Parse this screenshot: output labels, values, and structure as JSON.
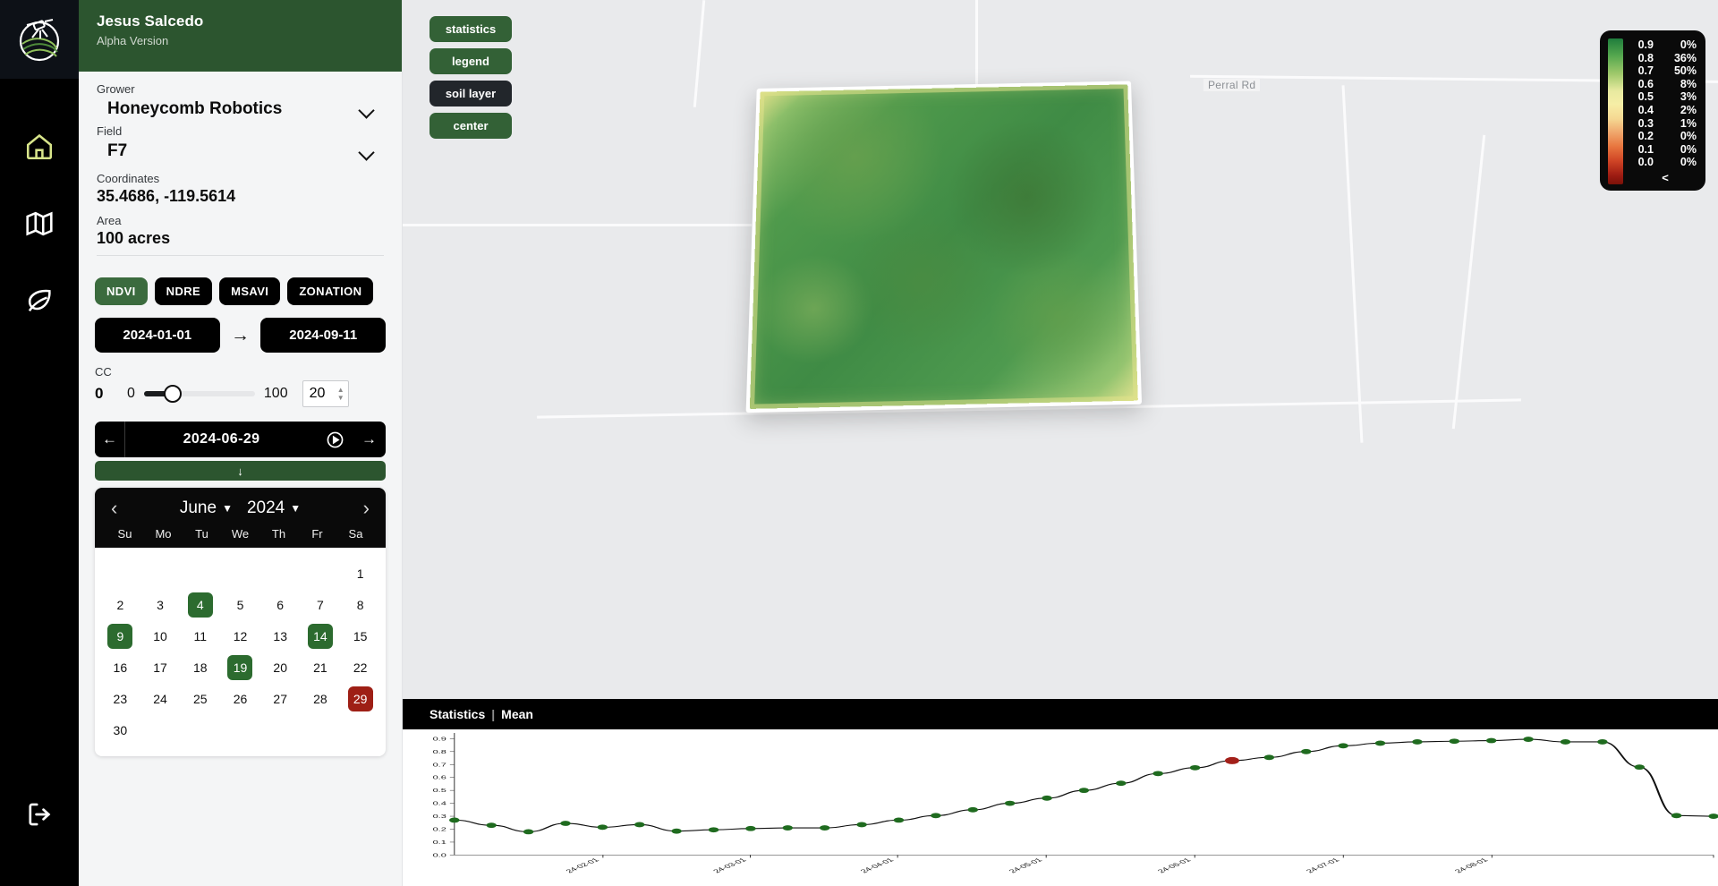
{
  "rail": {
    "logo_icon": "satellite-field-logo",
    "items": [
      {
        "icon": "home-icon",
        "name": "home",
        "active": true
      },
      {
        "icon": "map-icon",
        "name": "map",
        "active": false
      },
      {
        "icon": "leaf-icon",
        "name": "crops",
        "active": false
      }
    ],
    "logout_icon": "logout-icon"
  },
  "panel": {
    "user_name": "Jesus Salcedo",
    "version": "Alpha Version",
    "grower_label": "Grower",
    "grower_value": "Honeycomb Robotics",
    "field_label": "Field",
    "field_value": "F7",
    "coordinates_label": "Coordinates",
    "coordinates_value": "35.4686, -119.5614",
    "area_label": "Area",
    "area_value": "100 acres",
    "indices": [
      {
        "label": "NDVI",
        "active": true
      },
      {
        "label": "NDRE",
        "active": false
      },
      {
        "label": "MSAVI",
        "active": false
      },
      {
        "label": "ZONATION",
        "active": false
      }
    ],
    "date_from": "2024-01-01",
    "date_to": "2024-09-11",
    "date_range_arrow": "arrow-right-icon",
    "cc_label": "CC",
    "cc_current": "0",
    "cc_min": "0",
    "cc_max": "100",
    "cc_value": "20",
    "nav": {
      "prev_icon": "arrow-left-icon",
      "current_date": "2024-06-29",
      "play_icon": "play-circle-icon",
      "next_icon": "arrow-right-icon",
      "expand_icon": "arrow-down-icon"
    },
    "calendar": {
      "prev_icon": "chevron-left-icon",
      "next_icon": "chevron-right-icon",
      "month": "June",
      "year": "2024",
      "dow": [
        "Su",
        "Mo",
        "Tu",
        "We",
        "Th",
        "Fr",
        "Sa"
      ],
      "leading_blanks": 6,
      "days": [
        1,
        2,
        3,
        4,
        5,
        6,
        7,
        8,
        9,
        10,
        11,
        12,
        13,
        14,
        15,
        16,
        17,
        18,
        19,
        20,
        21,
        22,
        23,
        24,
        25,
        26,
        27,
        28,
        29,
        30
      ],
      "available_days": [
        4,
        9,
        14,
        19
      ],
      "selected_day": 29
    }
  },
  "map": {
    "buttons": [
      {
        "label": "statistics",
        "active": false
      },
      {
        "label": "legend",
        "active": false
      },
      {
        "label": "soil layer",
        "active": true
      },
      {
        "label": "center",
        "active": false
      }
    ],
    "road_label": "Perral Rd",
    "legend": {
      "rows": [
        {
          "level": "0.9",
          "percent": "0%"
        },
        {
          "level": "0.8",
          "percent": "36%"
        },
        {
          "level": "0.7",
          "percent": "50%"
        },
        {
          "level": "0.6",
          "percent": "8%"
        },
        {
          "level": "0.5",
          "percent": "3%"
        },
        {
          "level": "0.4",
          "percent": "2%"
        },
        {
          "level": "0.3",
          "percent": "1%"
        },
        {
          "level": "0.2",
          "percent": "0%"
        },
        {
          "level": "0.1",
          "percent": "0%"
        },
        {
          "level": "0.0",
          "percent": "0%"
        }
      ],
      "more_icon": "<"
    }
  },
  "stats": {
    "title": "Statistics",
    "separator": "|",
    "metric": "Mean"
  },
  "chart_data": {
    "type": "line",
    "title": "Statistics | Mean",
    "xlabel": "",
    "ylabel": "",
    "ylim": [
      0.0,
      0.93
    ],
    "yticks": [
      "0.0",
      "0.1",
      "0.2",
      "0.3",
      "0.4",
      "0.5",
      "0.6",
      "0.7",
      "0.8",
      "0.9"
    ],
    "xticks": [
      "24-02-01",
      "24-03-01",
      "24-04-01",
      "24-05-01",
      "24-06-01",
      "24-07-01",
      "24-08-01"
    ],
    "xlim": [
      "24-01-01",
      "24-09-11"
    ],
    "grid": false,
    "legend": "none",
    "point_color": "#1f6b1f",
    "selected_point_color": "#a3201a",
    "line_color": "#111111",
    "selected_index": 21,
    "x": [
      "24-01-05",
      "24-01-20",
      "24-02-04",
      "24-02-19",
      "24-03-05",
      "24-03-20",
      "24-04-04",
      "24-04-19",
      "24-05-04",
      "24-05-14",
      "24-05-24",
      "24-06-01",
      "24-06-06",
      "24-06-11",
      "24-06-16",
      "24-06-21",
      "24-06-24",
      "24-06-27",
      "24-06-29",
      "24-07-02",
      "24-07-06",
      "24-07-10",
      "24-07-14",
      "24-07-18",
      "24-07-22",
      "24-07-26",
      "24-07-30",
      "24-08-03",
      "24-08-07",
      "24-08-11",
      "24-08-16",
      "24-08-22",
      "24-08-30",
      "24-09-05",
      "24-09-11"
    ],
    "values": [
      0.27,
      0.23,
      0.18,
      0.245,
      0.215,
      0.235,
      0.185,
      0.195,
      0.205,
      0.21,
      0.21,
      0.235,
      0.27,
      0.305,
      0.35,
      0.4,
      0.44,
      0.5,
      0.555,
      0.63,
      0.675,
      0.73,
      0.755,
      0.8,
      0.845,
      0.865,
      0.875,
      0.88,
      0.885,
      0.895,
      0.875,
      0.875,
      0.68,
      0.305,
      0.3
    ]
  }
}
